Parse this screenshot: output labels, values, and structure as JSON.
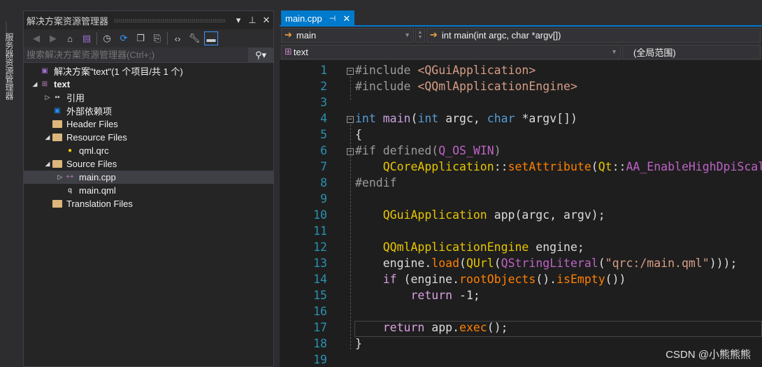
{
  "side_strip": {
    "label": "服务器资源管理器"
  },
  "solution_explorer": {
    "title": "解决方案资源管理器",
    "search_placeholder": "搜索解决方案资源管理器(Ctrl+;)",
    "tree": [
      {
        "label": "解决方案\"text\"(1 个项目/共 1 个)",
        "level": 0,
        "expander": "",
        "icon": "solution"
      },
      {
        "label": "text",
        "level": 0,
        "expander": "◢",
        "icon": "project",
        "bold": true
      },
      {
        "label": "引用",
        "level": 1,
        "expander": "▷",
        "icon": "references"
      },
      {
        "label": "外部依赖项",
        "level": 1,
        "expander": "",
        "icon": "external"
      },
      {
        "label": "Header Files",
        "level": 1,
        "expander": "",
        "icon": "filter-folder"
      },
      {
        "label": "Resource Files",
        "level": 1,
        "expander": "◢",
        "icon": "filter-folder"
      },
      {
        "label": "qml.qrc",
        "level": 2,
        "expander": "",
        "icon": "qrc"
      },
      {
        "label": "Source Files",
        "level": 1,
        "expander": "◢",
        "icon": "filter-folder"
      },
      {
        "label": "main.cpp",
        "level": 2,
        "expander": "▷",
        "icon": "cpp",
        "selected": true
      },
      {
        "label": "main.qml",
        "level": 2,
        "expander": "",
        "icon": "qml"
      },
      {
        "label": "Translation Files",
        "level": 1,
        "expander": "",
        "icon": "filter-folder"
      }
    ]
  },
  "editor": {
    "tab": {
      "label": "main.cpp"
    },
    "nav": {
      "scope": "main",
      "member": "int main(int argc, char *argv[])",
      "project": "text",
      "global": "(全局范围)"
    },
    "current_line": 17,
    "lines": [
      [
        [
          "#include ",
          "pp"
        ],
        [
          "<QGuiApplication>",
          "inc"
        ]
      ],
      [
        [
          "#include ",
          "pp"
        ],
        [
          "<QQmlApplicationEngine>",
          "inc"
        ]
      ],
      [],
      [
        [
          "int ",
          "kw"
        ],
        [
          "main",
          "fn"
        ],
        [
          "(",
          "pl"
        ],
        [
          "int ",
          "kw"
        ],
        [
          "argc, ",
          "pl"
        ],
        [
          "char ",
          "kw"
        ],
        [
          "*argv[])",
          "pl"
        ]
      ],
      [
        [
          "{",
          "pl"
        ]
      ],
      [
        [
          "#if defined(",
          "pp"
        ],
        [
          "Q_OS_WIN",
          "ma"
        ],
        [
          ")",
          "pp"
        ]
      ],
      [
        [
          "    QCoreApplication",
          "ty"
        ],
        [
          "::",
          "pl"
        ],
        [
          "setAttribute",
          "me"
        ],
        [
          "(",
          "pl"
        ],
        [
          "Qt",
          "ty"
        ],
        [
          "::",
          "pl"
        ],
        [
          "AA_EnableHighDpiScaling",
          "ma"
        ],
        [
          ");",
          "pl"
        ]
      ],
      [
        [
          "#endif",
          "pp"
        ]
      ],
      [],
      [
        [
          "    QGuiApplication ",
          "ty"
        ],
        [
          "app(argc, argv);",
          "pl"
        ]
      ],
      [],
      [
        [
          "    QQmlApplicationEngine ",
          "ty"
        ],
        [
          "engine;",
          "pl"
        ]
      ],
      [
        [
          "    engine.",
          "pl"
        ],
        [
          "load",
          "me"
        ],
        [
          "(",
          "pl"
        ],
        [
          "QUrl",
          "ty"
        ],
        [
          "(",
          "pl"
        ],
        [
          "QStringLiteral",
          "ma"
        ],
        [
          "(",
          "pl"
        ],
        [
          "\"qrc:/main.qml\"",
          "st"
        ],
        [
          ")));",
          "pl"
        ]
      ],
      [
        [
          "    if ",
          "rt"
        ],
        [
          "(engine.",
          "pl"
        ],
        [
          "rootObjects",
          "me"
        ],
        [
          "().",
          "pl"
        ],
        [
          "isEmpty",
          "me"
        ],
        [
          "())",
          "pl"
        ]
      ],
      [
        [
          "        return ",
          "rt"
        ],
        [
          "-1;",
          "pl"
        ]
      ],
      [],
      [
        [
          "    return ",
          "rt"
        ],
        [
          "app.",
          "pl"
        ],
        [
          "exec",
          "me"
        ],
        [
          "();",
          "pl"
        ]
      ],
      [
        [
          "}",
          "pl"
        ]
      ],
      []
    ]
  },
  "watermark": "CSDN @小熊熊熊"
}
